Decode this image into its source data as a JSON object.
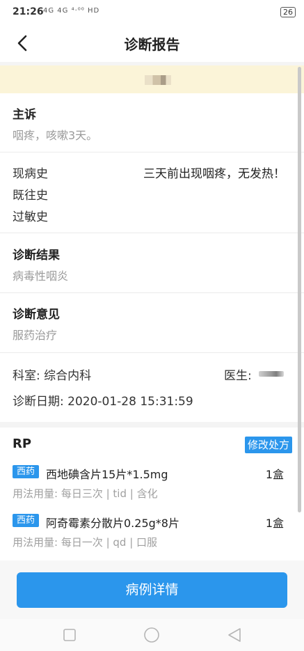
{
  "status_bar": {
    "time": "21:26",
    "signal_text": "4G 4G ⁴·⁰⁰ HD",
    "battery": "26"
  },
  "nav": {
    "title": "诊断报告"
  },
  "chief_complaint": {
    "title": "主诉",
    "text": "咽疼，咳嗽3天。"
  },
  "history": {
    "present_label": "现病史",
    "present_value": "三天前出现咽疼，无发热！",
    "past_label": "既往史",
    "allergy_label": "过敏史"
  },
  "diagnosis_result": {
    "title": "诊断结果",
    "text": "病毒性咽炎"
  },
  "diagnosis_opinion": {
    "title": "诊断意见",
    "text": "服药治疗"
  },
  "info": {
    "department": "科室: 综合内科",
    "doctor_label": "医生:",
    "date": "诊断日期: 2020-01-28 15:31:59"
  },
  "rp": {
    "title": "RP",
    "edit_label": "修改处方",
    "drugs": [
      {
        "tag": "西药",
        "name": "西地碘含片15片*1.5mg",
        "qty": "1盒",
        "usage": "用法用量: 每日三次 | tid | 含化"
      },
      {
        "tag": "西药",
        "name": "阿奇霉素分散片0.25g*8片",
        "qty": "1盒",
        "usage": "用法用量: 每日一次 | qd | 口服"
      }
    ]
  },
  "bottom": {
    "detail_label": "病例详情"
  },
  "icons": {
    "back": "chevron-left-icon",
    "nav_square": "square-icon",
    "nav_circle": "circle-icon",
    "nav_triangle": "triangle-back-icon"
  },
  "colors": {
    "accent": "#2b96ec",
    "banner": "#fbf4d8"
  }
}
